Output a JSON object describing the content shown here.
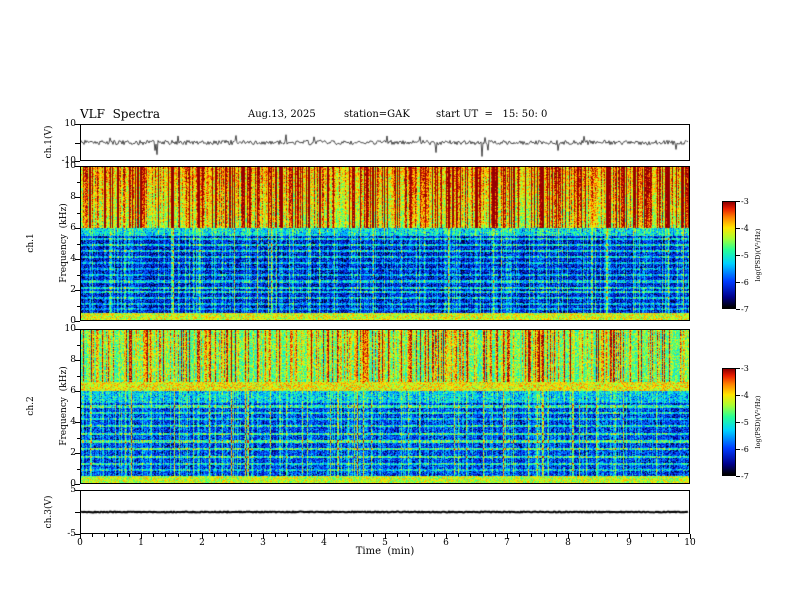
{
  "header": {
    "title": "VLF  Spectra",
    "date": "Aug.13, 2025",
    "station": "station=GAK",
    "start_ut": "start UT  =   15: 50: 0"
  },
  "chart_data": {
    "type": "heatmap",
    "title": "VLF Spectra",
    "xlabel": "Time  (min)",
    "xlim": [
      0,
      10
    ],
    "xticks": [
      0,
      1,
      2,
      3,
      4,
      5,
      6,
      7,
      8,
      9,
      10
    ],
    "x_minor_step": 0.2,
    "panels": [
      {
        "id": "ch1-waveform",
        "kind": "line",
        "ylabel": "ch.1(V)",
        "ylim": [
          -10,
          10
        ],
        "yticks": [
          10,
          0,
          -10
        ],
        "ytick_labels": [
          10,
          -10
        ],
        "line_color": "#000000",
        "noise_amp_v": 1.3,
        "spike_down_v": -9,
        "spike_up_v": 4.5,
        "description": "broadband noise around 0 V with sporadic impulsive spikes down to about -9 V"
      },
      {
        "id": "ch1-spectrogram",
        "kind": "spectrogram",
        "ylabel_line1": "ch.1",
        "ylabel_line2": "Frequency  (kHz)",
        "ylim": [
          0,
          10
        ],
        "yticks": [
          0,
          2,
          4,
          6,
          8,
          10
        ],
        "ytick_labels": [
          0,
          2,
          4,
          6,
          8,
          10
        ],
        "yticks_minor": [
          1,
          3,
          5,
          7,
          9
        ],
        "clim": [
          -7,
          -3
        ],
        "bands": [
          {
            "range": [
              6,
              10.01
            ],
            "level": -4.55,
            "grad": 0.5,
            "streak": "upper",
            "streak_scale": 1.0,
            "description": "green-yellow background 6-10 kHz with dense red/orange vertical streaks"
          },
          {
            "range": [
              5.5,
              6
            ],
            "level": -5.35,
            "streak": "lower",
            "streak_scale": 0.6,
            "description": "cyan transition band"
          },
          {
            "range": [
              0.45,
              5.5
            ],
            "level": -6.45,
            "streak": "lower",
            "streak_scale": 1.0,
            "description": "dark blue/black region with blue horizontal lines and cyan vertical streaks"
          },
          {
            "range": [
              0,
              0.45
            ],
            "level": -4.15,
            "streak": "none",
            "description": "bright yellow-green band at lowest frequencies"
          }
        ],
        "horizontal_lines": {
          "freqs": [
            0.7,
            1.0,
            1.4,
            1.8,
            2.1,
            2.5,
            2.9,
            3.3,
            3.7,
            4.1,
            4.5,
            4.9,
            5.3
          ],
          "boost": 0.85
        }
      },
      {
        "id": "ch2-spectrogram",
        "kind": "spectrogram",
        "ylabel_line1": "ch.2",
        "ylabel_line2": "Frequency  (kHz)",
        "ylim": [
          0,
          10
        ],
        "yticks": [
          0,
          2,
          4,
          6,
          8,
          10
        ],
        "ytick_labels": [
          0,
          2,
          4,
          6,
          8,
          10
        ],
        "yticks_minor": [
          1,
          3,
          5,
          7,
          9
        ],
        "clim": [
          -7,
          -3
        ],
        "bands": [
          {
            "range": [
              6.6,
              10.01
            ],
            "level": -4.85,
            "grad": 0.15,
            "streak": "upper",
            "streak_scale": 0.8,
            "description": "green/cyan background with yellow and red vertical streaks"
          },
          {
            "range": [
              6.0,
              6.6
            ],
            "level": -4.05,
            "streak": "none",
            "description": "bright yellow-green horizontal band near 6 kHz"
          },
          {
            "range": [
              5.2,
              6.0
            ],
            "level": -5.5,
            "streak": "lower",
            "streak_scale": 0.7,
            "description": "cyan-blue transition region"
          },
          {
            "range": [
              0.45,
              5.2
            ],
            "level": -6.25,
            "streak": "lower",
            "streak_scale": 1.25,
            "description": "blue/dark blue region with cyan-green horizontal lines"
          },
          {
            "range": [
              0,
              0.45
            ],
            "level": -4.25,
            "streak": "none",
            "description": "bright yellow-green band at lowest frequencies"
          }
        ],
        "horizontal_lines": {
          "freqs": [
            0.8,
            1.2,
            1.7,
            2.2,
            2.7,
            3.2,
            3.7,
            4.2,
            4.6,
            5.0
          ],
          "boost": 1.0
        }
      },
      {
        "id": "ch3-waveform",
        "kind": "line",
        "flat": true,
        "ylabel": "ch.3(V)",
        "ylim": [
          -5,
          5
        ],
        "yticks": [
          5,
          0,
          -5
        ],
        "ytick_labels": [
          5,
          -5
        ],
        "line_color": "#000000",
        "description": "constant flat trace at 0 V"
      }
    ],
    "colorbar": {
      "label": "log(PSD)(V²/Hz)",
      "ticks": [
        -3,
        -4,
        -5,
        -6,
        -7
      ],
      "range": [
        -7,
        -3
      ],
      "colormap": "jet"
    }
  }
}
